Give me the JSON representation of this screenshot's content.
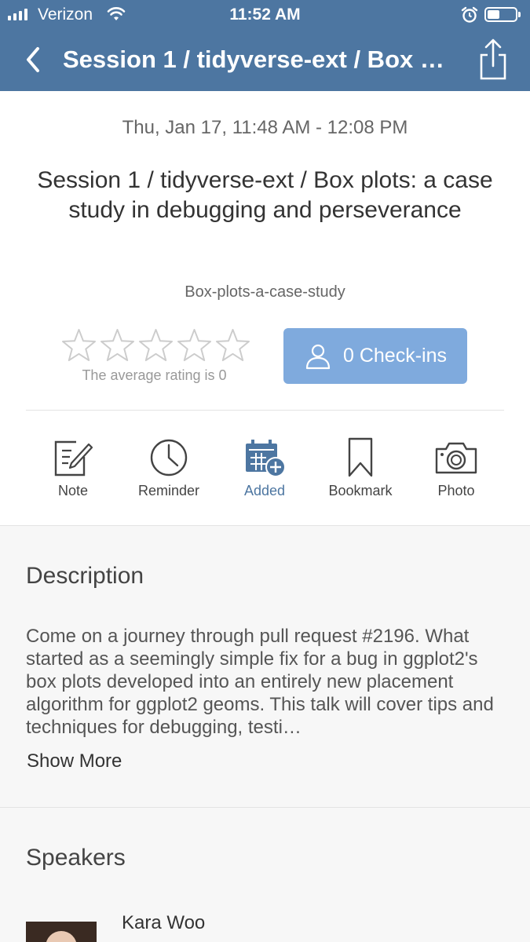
{
  "status_bar": {
    "carrier": "Verizon",
    "time": "11:52 AM",
    "battery_level": 0.45,
    "icons": [
      "signal-icon",
      "wifi-icon",
      "alarm-icon",
      "battery-icon"
    ]
  },
  "nav": {
    "title": "Session 1 / tidyverse-ext / Box pl...",
    "back_icon": "chevron-left-icon",
    "share_icon": "share-icon"
  },
  "session": {
    "datetime": "Thu, Jan 17, 11:48 AM - 12:08 PM",
    "title": "Session 1 / tidyverse-ext / Box plots: a case study in debugging and perseverance",
    "track": "Box-plots-a-case-study"
  },
  "rating": {
    "stars_total": 5,
    "stars_filled": 0,
    "average_label": "The average rating is 0"
  },
  "checkin": {
    "label": "0 Check-ins",
    "icon": "user-icon",
    "color": "#7faadd"
  },
  "actions": {
    "note": "Note",
    "reminder": "Reminder",
    "added": "Added",
    "bookmark": "Bookmark",
    "photo": "Photo"
  },
  "description": {
    "heading": "Description",
    "text": "Come on a journey through pull request #2196. What started as a seemingly simple fix for a bug in ggplot2's box plots developed into an entirely new placement algorithm for ggplot2 geoms. This talk will cover tips and techniques for debugging, testi…",
    "show_more": "Show More"
  },
  "speakers": {
    "heading": "Speakers",
    "items": [
      {
        "name": "Kara Woo"
      }
    ]
  },
  "colors": {
    "brand": "#4d76a1",
    "accent": "#7faadd"
  }
}
